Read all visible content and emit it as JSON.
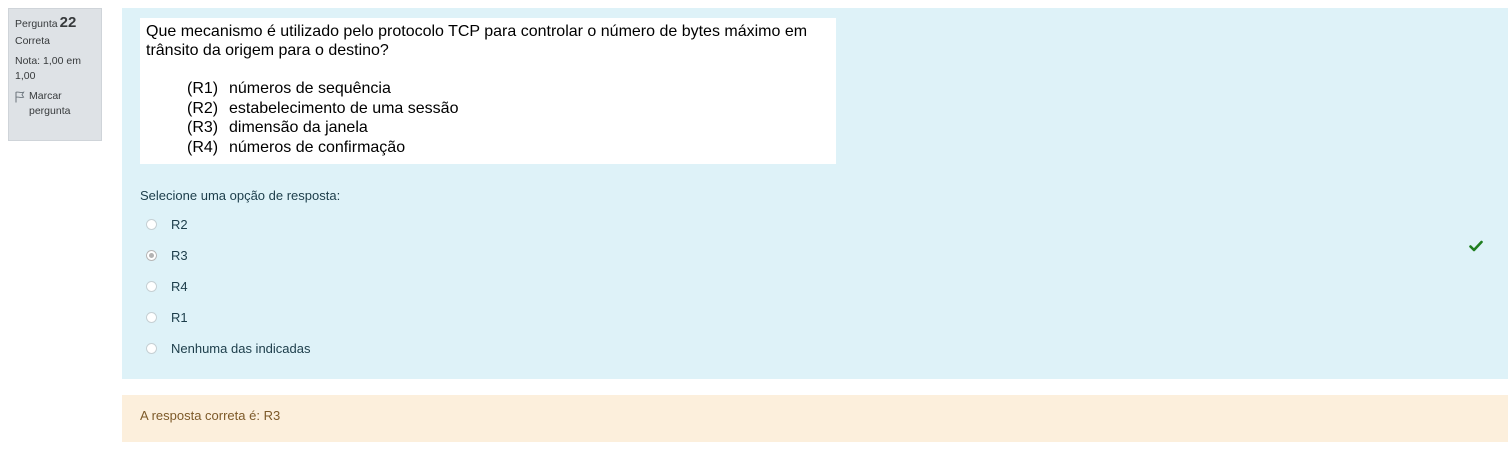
{
  "info": {
    "question_label": "Pergunta",
    "question_number": "22",
    "state": "Correta",
    "grade": "Nota: 1,00 em 1,00",
    "flag_label": "Marcar pergunta",
    "flag_icon": "flag-icon"
  },
  "question": {
    "text": "Que mecanismo é utilizado pelo protocolo TCP para controlar o número de bytes máximo em trânsito da origem para o destino?",
    "options": [
      {
        "code": "(R1)",
        "text": "números de sequência"
      },
      {
        "code": "(R2)",
        "text": "estabelecimento de uma sessão"
      },
      {
        "code": "(R3)",
        "text": "dimensão da janela"
      },
      {
        "code": "(R4)",
        "text": "números de confirmação"
      }
    ]
  },
  "answer": {
    "prompt": "Selecione uma opção de resposta:",
    "choices": [
      {
        "label": "R2",
        "selected": false
      },
      {
        "label": "R3",
        "selected": true
      },
      {
        "label": "R4",
        "selected": false
      },
      {
        "label": "R1",
        "selected": false
      },
      {
        "label": "Nenhuma das indicadas",
        "selected": false
      }
    ],
    "correct_icon": "check-icon",
    "correct_color": "#1f7e1f"
  },
  "feedback": {
    "text": "A resposta correta é: R3"
  },
  "colors": {
    "info_bg": "#dee2e6",
    "formulation_bg": "#def2f8",
    "feedback_bg": "#fcefdc",
    "feedback_text": "#7d5a29"
  }
}
